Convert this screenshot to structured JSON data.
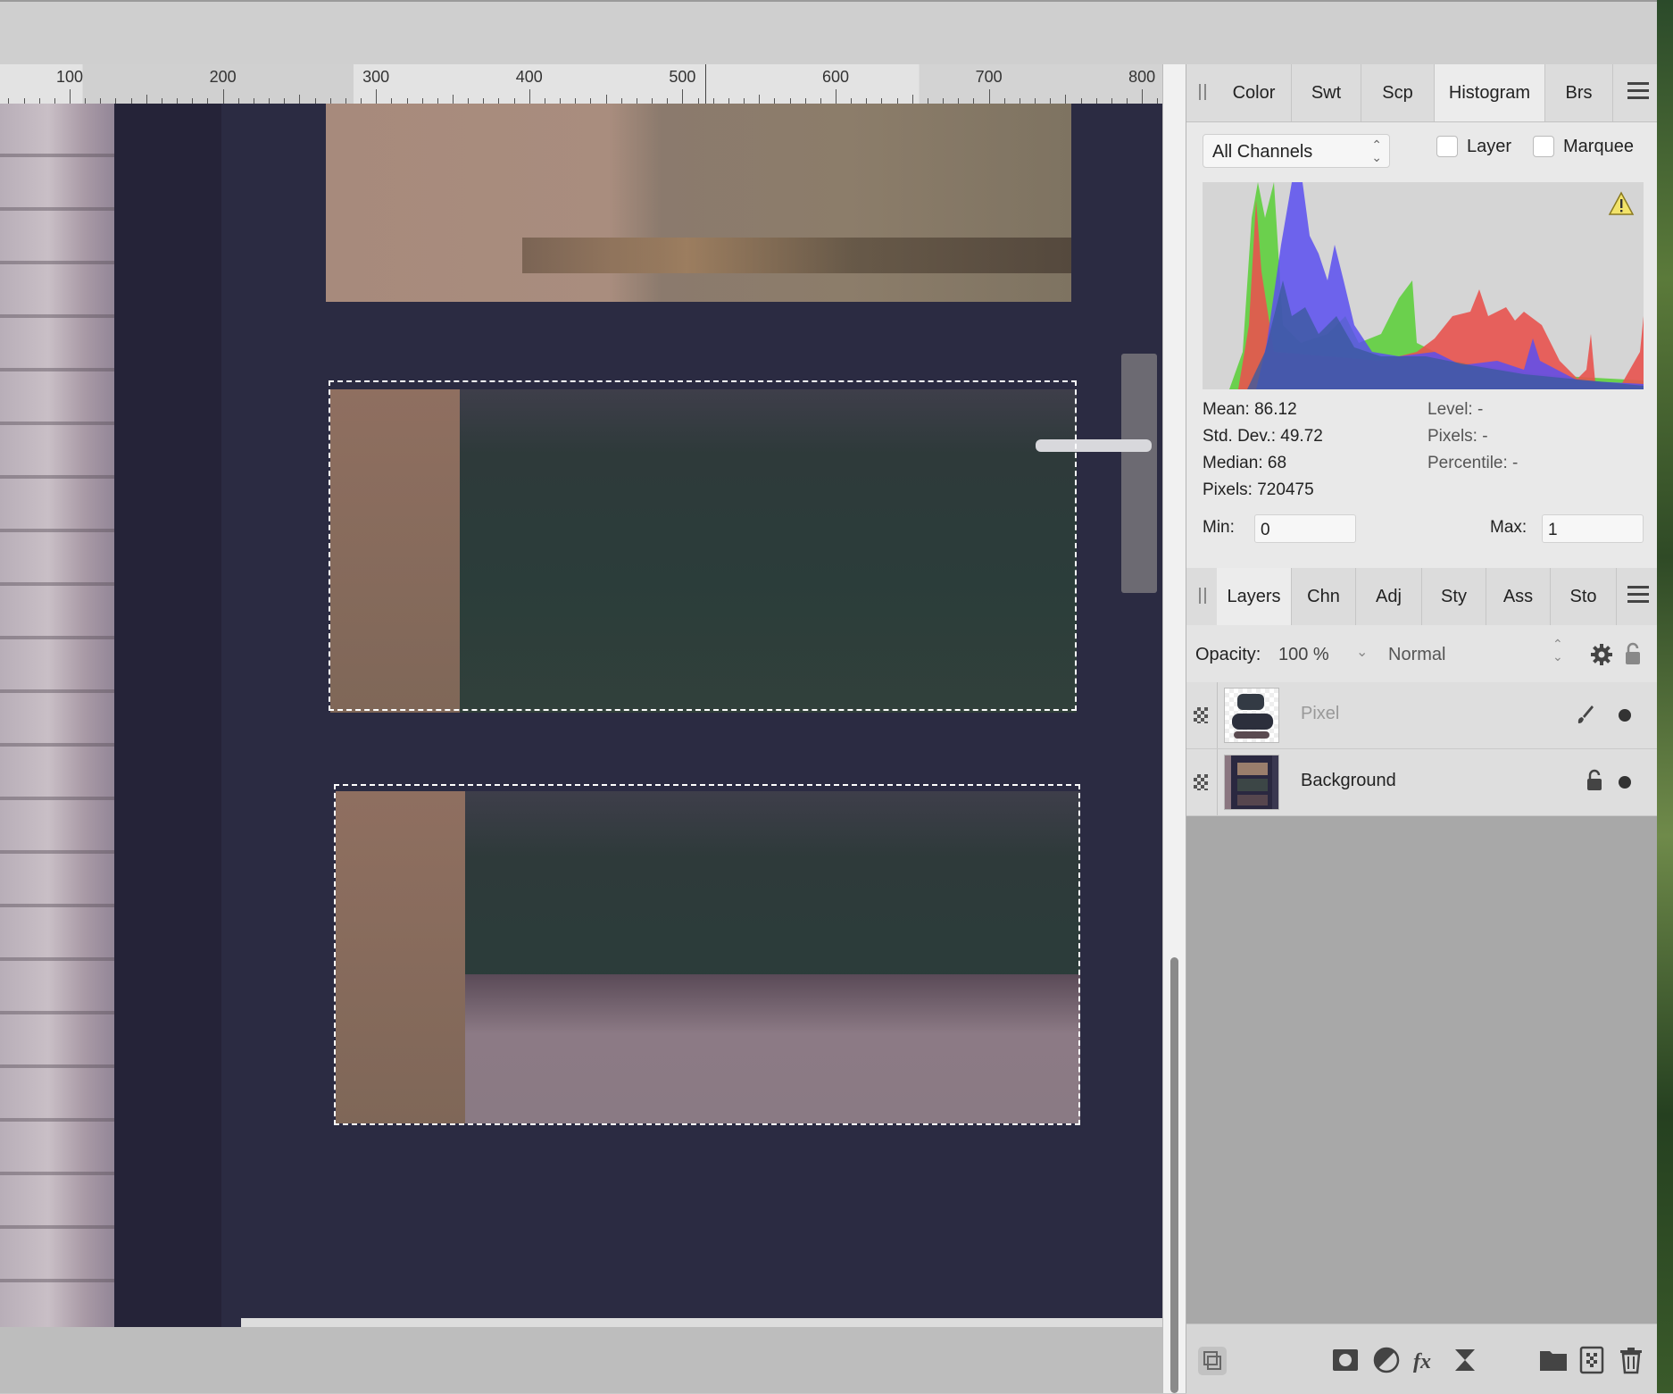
{
  "ruler": {
    "labels": [
      "100",
      "200",
      "300",
      "400",
      "500",
      "600",
      "700",
      "800"
    ]
  },
  "histogram_panel": {
    "tabs": [
      "Color",
      "Swt",
      "Scp",
      "Histogram",
      "Brs"
    ],
    "active_tab": "Histogram",
    "channel_select": "All Channels",
    "checkboxes": {
      "layer": "Layer",
      "marquee": "Marquee"
    },
    "stats": {
      "mean": "Mean: 86.12",
      "std_dev": "Std. Dev.: 49.72",
      "median": "Median: 68",
      "pixels": "Pixels: 720475",
      "level": "Level: -",
      "pixels_right": "Pixels: -",
      "percentile": "Percentile: -"
    },
    "min_label": "Min:",
    "min_value": "0",
    "max_label": "Max:",
    "max_value": "1",
    "warning_icon": "warning-icon"
  },
  "layers_panel": {
    "tabs": [
      "Layers",
      "Chn",
      "Adj",
      "Sty",
      "Ass",
      "Sto"
    ],
    "active_tab": "Layers",
    "opacity_label": "Opacity:",
    "opacity_value": "100 %",
    "blend_mode": "Normal",
    "layers": [
      {
        "name": "Pixel",
        "icons": [
          "brush-icon",
          "visibility-dot-icon"
        ]
      },
      {
        "name": "Background",
        "icons": [
          "lock-icon",
          "visibility-dot-icon"
        ]
      }
    ]
  },
  "colors": {
    "hist_red": "#e8534f",
    "hist_green": "#5fcf3e",
    "hist_blue": "#5a4ff0",
    "panel_bg": "#e9e9e9"
  }
}
